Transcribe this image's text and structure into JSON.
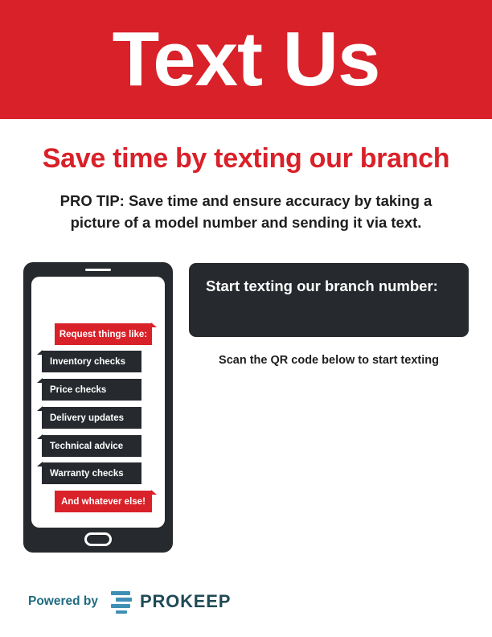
{
  "header": {
    "title": "Text Us"
  },
  "subhead": "Save time by texting our branch",
  "pro_tip": {
    "line1": "PRO TIP: Save time and ensure accuracy by taking a",
    "line2": "picture of a model number and sending it via text."
  },
  "phone": {
    "messages": [
      {
        "text": "Request things like:",
        "style": "incoming"
      },
      {
        "text": "Inventory checks",
        "style": "outgoing"
      },
      {
        "text": "Price checks",
        "style": "outgoing"
      },
      {
        "text": "Delivery updates",
        "style": "outgoing"
      },
      {
        "text": "Technical advice",
        "style": "outgoing"
      },
      {
        "text": "Warranty checks",
        "style": "outgoing"
      },
      {
        "text": "And whatever else!",
        "style": "incoming"
      }
    ]
  },
  "cta": {
    "title": "Start texting our branch number:"
  },
  "scan_text": "Scan the QR code below to start texting",
  "footer": {
    "powered_by": "Powered by",
    "brand": "PROKEEP"
  },
  "colors": {
    "brand_red": "#d92129",
    "dark": "#26292e",
    "teal": "#1f6b80",
    "logo_blue": "#3f8fb5"
  }
}
